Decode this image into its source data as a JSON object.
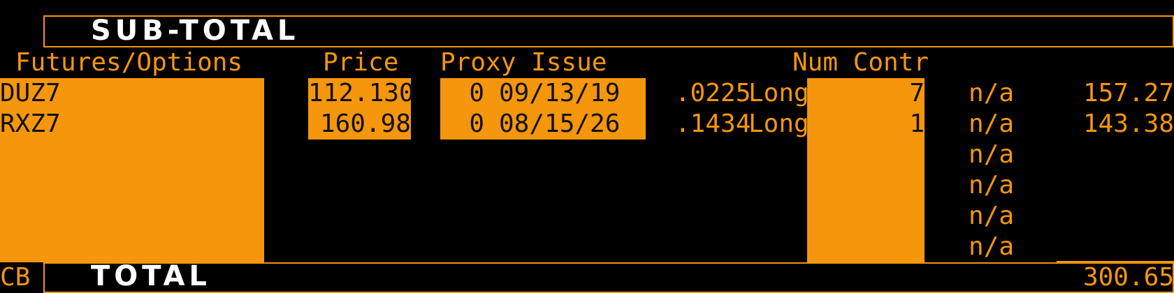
{
  "subtotal": {
    "title": "SUB-TOTAL"
  },
  "headers": {
    "futures_options": "Futures/Options",
    "price": "Price",
    "proxy_issue": "Proxy Issue",
    "num_contr": "Num Contr"
  },
  "rows": [
    {
      "ticker": "DUZ7",
      "price": "112.130",
      "proxy_qty": "0",
      "proxy_date": "09/13/19",
      "ratio": ".0225",
      "side": "Long",
      "contracts": "7",
      "status": "n/a",
      "value": "157.27"
    },
    {
      "ticker": "RXZ7",
      "price": "160.98",
      "proxy_qty": "0",
      "proxy_date": "08/15/26",
      "ratio": ".1434",
      "side": "Long",
      "contracts": "1",
      "status": "n/a",
      "value": "143.38"
    },
    {
      "status": "n/a"
    },
    {
      "status": "n/a"
    },
    {
      "status": "n/a"
    },
    {
      "status": "n/a"
    }
  ],
  "footer": {
    "code": "CB",
    "title": "TOTAL",
    "total": "300.65"
  },
  "colors": {
    "accent": "#f5960c",
    "background": "#000000",
    "banner_text": "#ffffff"
  }
}
